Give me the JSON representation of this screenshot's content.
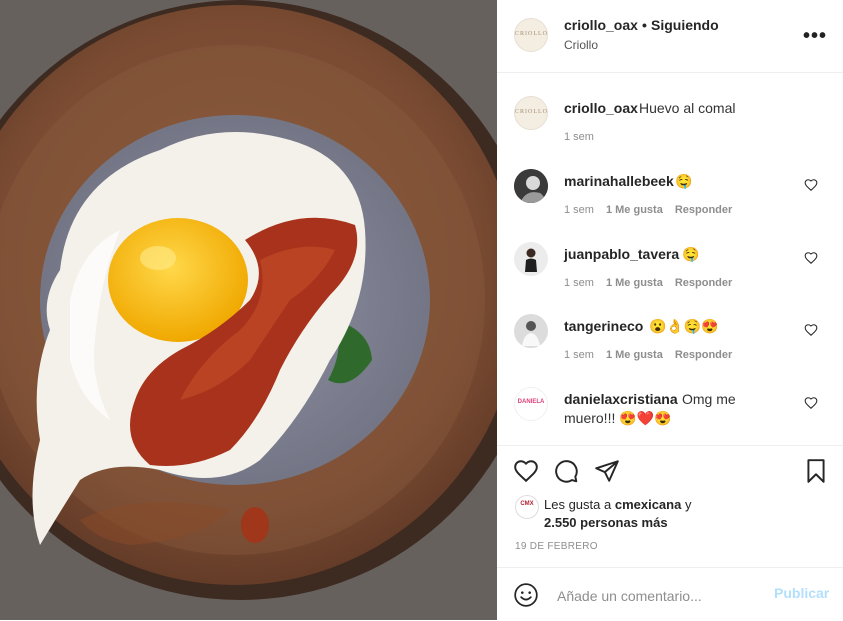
{
  "post": {
    "username": "criollo_oax",
    "separator": "•",
    "follow_status": "Siguiendo",
    "location": "Criollo",
    "avatar_text": "CRIOLLO",
    "more_label": "•••"
  },
  "caption": {
    "username": "criollo_oax",
    "text": "Huevo al comal",
    "time": "1 sem"
  },
  "comments": [
    {
      "username": "marinahallebeek",
      "text": "🤤",
      "time": "1 sem",
      "likes": "1 Me gusta",
      "reply": "Responder"
    },
    {
      "username": "juanpablo_tavera",
      "text": "🤤",
      "time": "1 sem",
      "likes": "1 Me gusta",
      "reply": "Responder"
    },
    {
      "username": "tangerineco",
      "text": "😮👌🤤😍",
      "time": "1 sem",
      "likes": "1 Me gusta",
      "reply": "Responder"
    },
    {
      "username": "danielaxcristiana",
      "text": "Omg me",
      "text_line2": "muero!!! 😍❤️😍",
      "avatar_text": "DANIELA"
    }
  ],
  "likes": {
    "prefix": "Les gusta a",
    "user": "cmexicana",
    "suffix": "y",
    "others": "2.550 personas más",
    "avatar_text": "CMX"
  },
  "date": "19 DE FEBRERO",
  "composer": {
    "placeholder": "Añade un comentario...",
    "publish_label": "Publicar"
  },
  "icons": {
    "like": "heart-icon",
    "comment": "comment-icon",
    "share": "share-icon",
    "save": "bookmark-icon",
    "emoji": "emoji-icon"
  },
  "colors": {
    "publish_disabled": "#b2dffc",
    "secondary_text": "#8e8e8e",
    "divider": "#efefef"
  }
}
